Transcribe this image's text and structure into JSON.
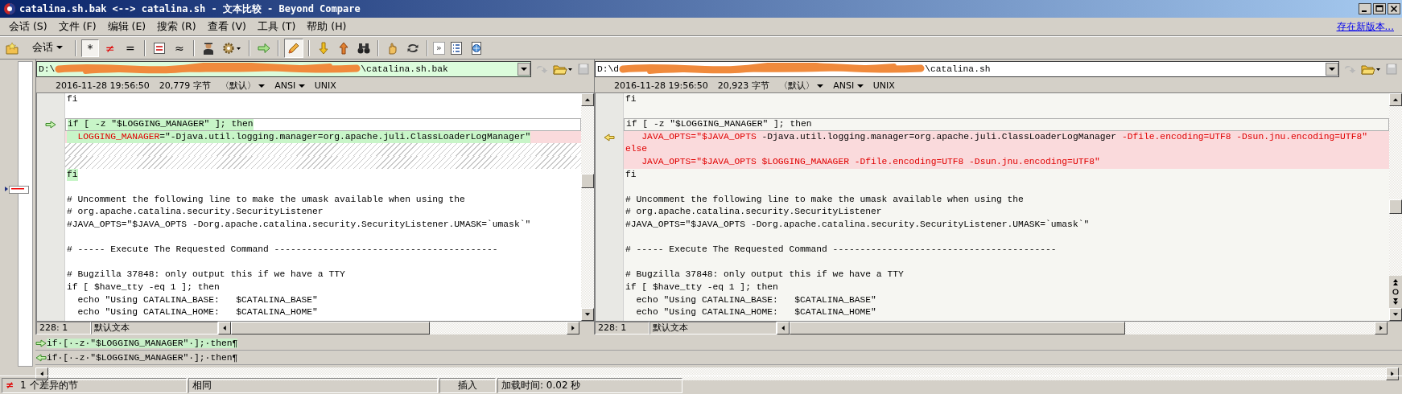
{
  "window": {
    "title": "catalina.sh.bak <--> catalina.sh - 文本比较 - Beyond Compare"
  },
  "menu": [
    {
      "label": "会话",
      "accel": "(S)"
    },
    {
      "label": "文件",
      "accel": "(F)"
    },
    {
      "label": "编辑",
      "accel": "(E)"
    },
    {
      "label": "搜索",
      "accel": "(R)"
    },
    {
      "label": "查看",
      "accel": "(V)"
    },
    {
      "label": "工具",
      "accel": "(T)"
    },
    {
      "label": "帮助",
      "accel": "(H)"
    }
  ],
  "update_link": "存在新版本...",
  "toolbar": {
    "session_label": "会话",
    "filters": [
      {
        "label": "*",
        "selected": true
      },
      {
        "label": "≠",
        "selected": false
      },
      {
        "label": "=",
        "selected": false
      }
    ],
    "approx_label": "≈",
    "edit_on": true,
    "more_label": "»"
  },
  "panes": [
    {
      "path_start": "D:\\",
      "path_end": "\\catalina.sh.bak",
      "redacted": true,
      "active": true,
      "date": "2016-11-28 19:56:50",
      "size": "20,779 字节",
      "format": "〈默认〉",
      "encoding": "ANSI",
      "line_end": "UNIX",
      "position": "228: 1",
      "text_mode": "默认文本",
      "lines": [
        {
          "kind": "plain",
          "text": "fi",
          "highlight": false,
          "marker": false
        },
        {
          "kind": "blank",
          "highlight": false,
          "marker": false
        },
        {
          "kind": "current",
          "text": "if [ -z \"$LOGGING_MANAGER\" ]; then",
          "highlight": true,
          "marker": true
        },
        {
          "kind": "changed",
          "segments": [
            {
              "text": "  LOGGING_MANAGER",
              "diff": true
            },
            {
              "text": "=\"-Djava.util.logging.manager=org.apache.juli.ClassLoaderLogManager\"",
              "diff": false
            }
          ],
          "highlight": true,
          "marker": false
        },
        {
          "kind": "missing",
          "highlight": false,
          "marker": false
        },
        {
          "kind": "missing",
          "highlight": false,
          "marker": false
        },
        {
          "kind": "plain",
          "text": "fi",
          "highlight": true,
          "marker": false
        },
        {
          "kind": "blank",
          "highlight": false,
          "marker": false
        },
        {
          "kind": "plain",
          "text": "# Uncomment the following line to make the umask available when using the",
          "highlight": false,
          "marker": false
        },
        {
          "kind": "plain",
          "text": "# org.apache.catalina.security.SecurityListener",
          "highlight": false,
          "marker": false
        },
        {
          "kind": "plain",
          "text": "#JAVA_OPTS=\"$JAVA_OPTS -Dorg.apache.catalina.security.SecurityListener.UMASK=`umask`\"",
          "highlight": false,
          "marker": false
        },
        {
          "kind": "blank",
          "highlight": false,
          "marker": false
        },
        {
          "kind": "plain",
          "text": "# ----- Execute The Requested Command -----------------------------------------",
          "highlight": false,
          "marker": false
        },
        {
          "kind": "blank",
          "highlight": false,
          "marker": false
        },
        {
          "kind": "plain",
          "text": "# Bugzilla 37848: only output this if we have a TTY",
          "highlight": false,
          "marker": false
        },
        {
          "kind": "plain",
          "text": "if [ $have_tty -eq 1 ]; then",
          "highlight": false,
          "marker": false
        },
        {
          "kind": "plain",
          "text": "  echo \"Using CATALINA_BASE:   $CATALINA_BASE\"",
          "highlight": false,
          "marker": false
        },
        {
          "kind": "plain",
          "text": "  echo \"Using CATALINA_HOME:   $CATALINA_HOME\"",
          "highlight": false,
          "marker": false
        }
      ]
    },
    {
      "path_start": "D:\\d",
      "path_end": "\\catalina.sh",
      "redacted": true,
      "active": false,
      "date": "2016-11-28 19:56:50",
      "size": "20,923 字节",
      "format": "〈默认〉",
      "encoding": "ANSI",
      "line_end": "UNIX",
      "position": "228: 1",
      "text_mode": "默认文本",
      "lines": [
        {
          "kind": "plain",
          "text": "fi",
          "highlight": false,
          "marker": false
        },
        {
          "kind": "blank",
          "highlight": false,
          "marker": false
        },
        {
          "kind": "current",
          "text": "if [ -z \"$LOGGING_MANAGER\" ]; then",
          "highlight": false,
          "marker": false
        },
        {
          "kind": "changed",
          "segments": [
            {
              "text": "   JAVA_OPTS=\"$JAVA_OPTS",
              "diff": true
            },
            {
              "text": " -Djava.util.logging.manager=org.apache.juli.ClassLoaderLogManager",
              "diff": false
            },
            {
              "text": " -Dfile.encoding=UTF8 -Dsun.jnu.encoding=UTF8\"",
              "diff": true
            }
          ],
          "highlight": false,
          "marker": true
        },
        {
          "kind": "changed",
          "segments": [
            {
              "text": "else",
              "diff": true
            }
          ],
          "highlight": false,
          "marker": false
        },
        {
          "kind": "changed",
          "segments": [
            {
              "text": "   JAVA_OPTS=\"$JAVA_OPTS $LOGGING_MANAGER -Dfile.encoding=UTF8 -Dsun.jnu.encoding=UTF8\"",
              "diff": true
            }
          ],
          "highlight": false,
          "marker": false
        },
        {
          "kind": "plain",
          "text": "fi",
          "highlight": false,
          "marker": false
        },
        {
          "kind": "blank",
          "highlight": false,
          "marker": false
        },
        {
          "kind": "plain",
          "text": "# Uncomment the following line to make the umask available when using the",
          "highlight": false,
          "marker": false
        },
        {
          "kind": "plain",
          "text": "# org.apache.catalina.security.SecurityListener",
          "highlight": false,
          "marker": false
        },
        {
          "kind": "plain",
          "text": "#JAVA_OPTS=\"$JAVA_OPTS -Dorg.apache.catalina.security.SecurityListener.UMASK=`umask`\"",
          "highlight": false,
          "marker": false
        },
        {
          "kind": "blank",
          "highlight": false,
          "marker": false
        },
        {
          "kind": "plain",
          "text": "# ----- Execute The Requested Command -----------------------------------------",
          "highlight": false,
          "marker": false
        },
        {
          "kind": "blank",
          "highlight": false,
          "marker": false
        },
        {
          "kind": "plain",
          "text": "# Bugzilla 37848: only output this if we have a TTY",
          "highlight": false,
          "marker": false
        },
        {
          "kind": "plain",
          "text": "if [ $have_tty -eq 1 ]; then",
          "highlight": false,
          "marker": false
        },
        {
          "kind": "plain",
          "text": "  echo \"Using CATALINA_BASE:   $CATALINA_BASE\"",
          "highlight": false,
          "marker": false
        },
        {
          "kind": "plain",
          "text": "  echo \"Using CATALINA_HOME:   $CATALINA_HOME\"",
          "highlight": false,
          "marker": false
        }
      ]
    }
  ],
  "detail_lines": [
    {
      "text": "if·[·-z·\"$LOGGING_MANAGER\"·];·then¶",
      "selected": true
    },
    {
      "text": "if·[·-z·\"$LOGGING_MANAGER\"·];·then¶",
      "selected": false
    }
  ],
  "status_bar": {
    "diff_glyph": "≠",
    "diff_count": "1 个差异的节",
    "state": "相同",
    "mode": "插入",
    "load_time": "加载时间:  0.02 秒"
  }
}
